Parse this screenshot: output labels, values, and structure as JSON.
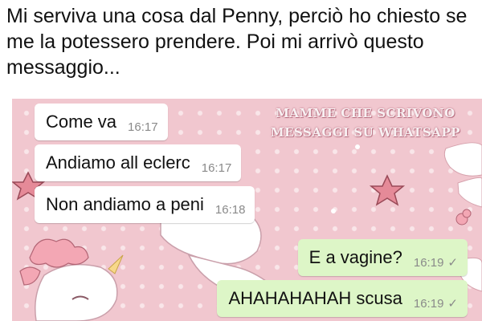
{
  "post": {
    "caption": "Mi serviva una cosa dal Penny, perciò ho chiesto se me la potessero prendere. Poi mi arrivò questo messaggio..."
  },
  "watermark": {
    "line1": "MAMME CHE SCRIVONO",
    "line2": "MESSAGGI SU WHATSAPP"
  },
  "chat": {
    "messages": [
      {
        "text": "Come va",
        "time": "16:17",
        "direction": "incoming"
      },
      {
        "text": "Andiamo all eclerc",
        "time": "16:17",
        "direction": "incoming"
      },
      {
        "text": "Non andiamo a peni",
        "time": "16:18",
        "direction": "incoming"
      },
      {
        "text": "E a vagine?",
        "time": "16:19",
        "direction": "outgoing",
        "status_icon": "check-icon"
      },
      {
        "text": "AHAHAHAHAH scusa",
        "time": "16:19",
        "direction": "outgoing",
        "status_icon": "check-icon"
      }
    ]
  },
  "colors": {
    "wallpaper": "#f1c7cf",
    "incoming_bubble": "#ffffff",
    "outgoing_bubble": "#ddf6c7",
    "timestamp": "#8a8a8a"
  }
}
